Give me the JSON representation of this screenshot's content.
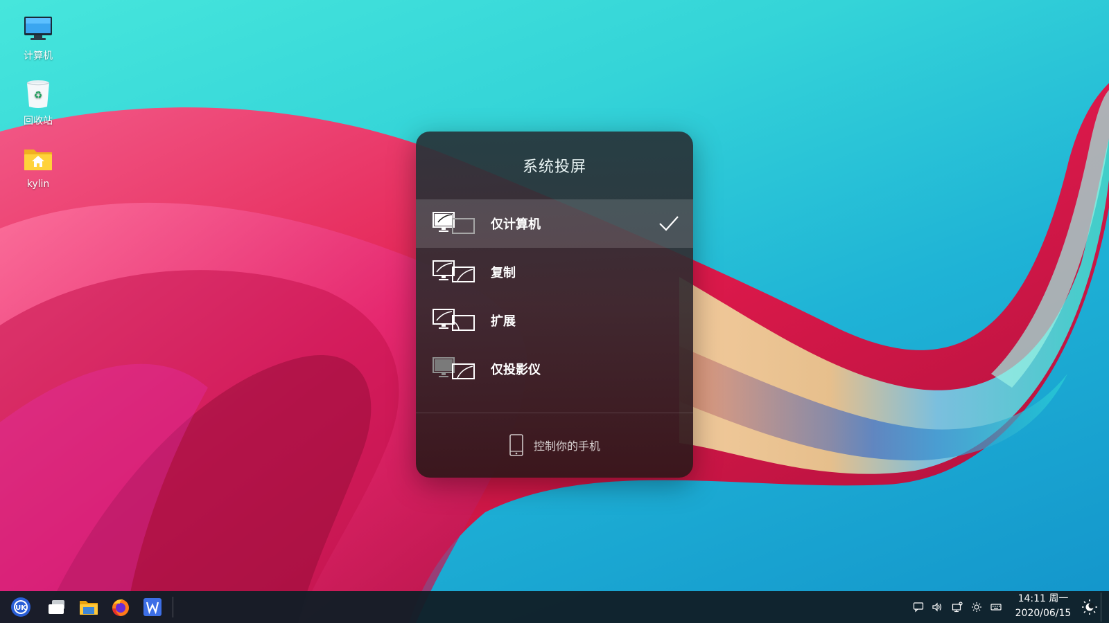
{
  "desktop": {
    "icons": [
      {
        "label": "计算机",
        "icon": "computer-icon"
      },
      {
        "label": "回收站",
        "icon": "trash-icon"
      },
      {
        "label": "kylin",
        "icon": "home-folder-icon"
      }
    ]
  },
  "dialog": {
    "title": "系统投屏",
    "options": [
      {
        "label": "仅计算机",
        "icon": "pc-only-icon",
        "selected": true
      },
      {
        "label": "复制",
        "icon": "mirror-icon",
        "selected": false
      },
      {
        "label": "扩展",
        "icon": "extend-icon",
        "selected": false
      },
      {
        "label": "仅投影仪",
        "icon": "projector-only-icon",
        "selected": false
      }
    ],
    "phone_link": {
      "label": "控制你的手机",
      "icon": "phone-icon"
    }
  },
  "taskbar": {
    "apps": [
      "start-menu-icon",
      "multitask-view-icon",
      "file-manager-icon",
      "firefox-icon",
      "wps-writer-icon"
    ],
    "tray": [
      "notification-icon",
      "volume-icon",
      "network-icon",
      "brightness-icon",
      "keyboard-icon"
    ],
    "clock": {
      "time": "14:11 周一",
      "date": "2020/06/15"
    },
    "night_mode_icon": "night-mode-icon"
  },
  "colors": {
    "sky": "#34d4d8",
    "wave_pink": "#e8194f",
    "wave_cyan": "#3fd6cf",
    "dialog_bg": "#2f3236",
    "taskbar_bg": "#101e26"
  }
}
